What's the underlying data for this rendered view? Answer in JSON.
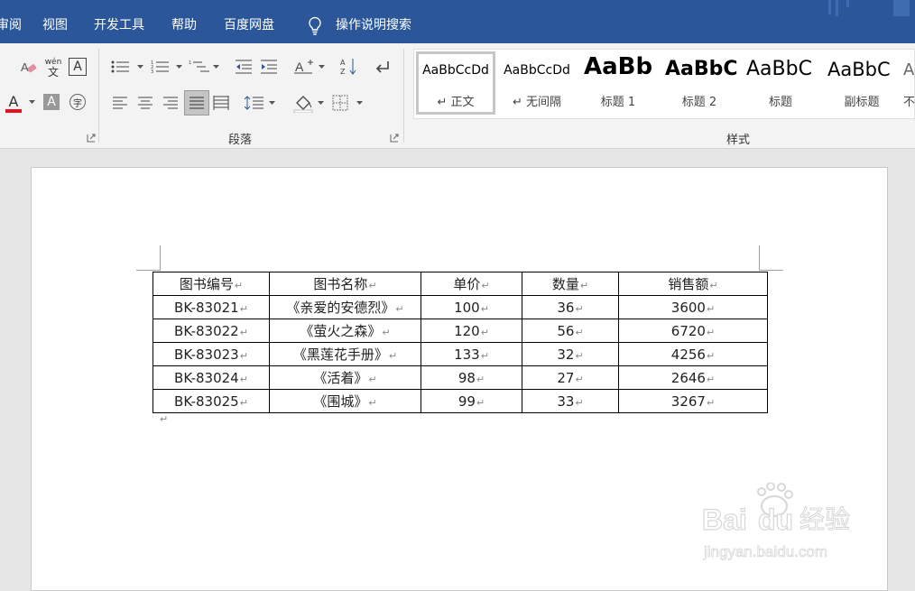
{
  "menu": {
    "items": [
      "审阅",
      "视图",
      "开发工具",
      "帮助",
      "百度网盘"
    ],
    "search_label": "操作说明搜索"
  },
  "ribbon": {
    "groups": {
      "paragraph": "段落",
      "styles": "样式"
    },
    "font_color_letter": "A",
    "highlight_letter": "A",
    "phonetic_top": "wén",
    "phonetic_bottom": "文",
    "char_border_letter": "A",
    "enclosed_char": "字",
    "styles": [
      {
        "preview": "AaBbCcDd",
        "name": "↵ 正文"
      },
      {
        "preview": "AaBbCcDd",
        "name": "↵ 无间隔"
      },
      {
        "preview": "AaBb",
        "name": "标题 1"
      },
      {
        "preview": "AaBbC",
        "name": "标题 2"
      },
      {
        "preview": "AaBbC",
        "name": "标题"
      },
      {
        "preview": "AaBbC",
        "name": "副标题"
      },
      {
        "preview": "A",
        "name": "不"
      }
    ]
  },
  "table": {
    "headers": [
      "图书编号",
      "图书名称",
      "单价",
      "数量",
      "销售额"
    ],
    "rows": [
      [
        "BK-83021",
        "《亲爱的安德烈》",
        "100",
        "36",
        "3600"
      ],
      [
        "BK-83022",
        "《萤火之森》",
        "120",
        "56",
        "6720"
      ],
      [
        "BK-83023",
        "《黑莲花手册》",
        "133",
        "32",
        "4256"
      ],
      [
        "BK-83024",
        "《活着》",
        "98",
        "27",
        "2646"
      ],
      [
        "BK-83025",
        "《围城》",
        "99",
        "33",
        "3267"
      ]
    ],
    "cell_mark": "↵"
  },
  "paragraph_mark": "↵",
  "watermark": {
    "brand": "Bai",
    "brand2": "du",
    "cn": "经验",
    "url": "jingyan.baidu.com"
  },
  "colors": {
    "menubar": "#2b579a",
    "font_color": "#e81123"
  }
}
